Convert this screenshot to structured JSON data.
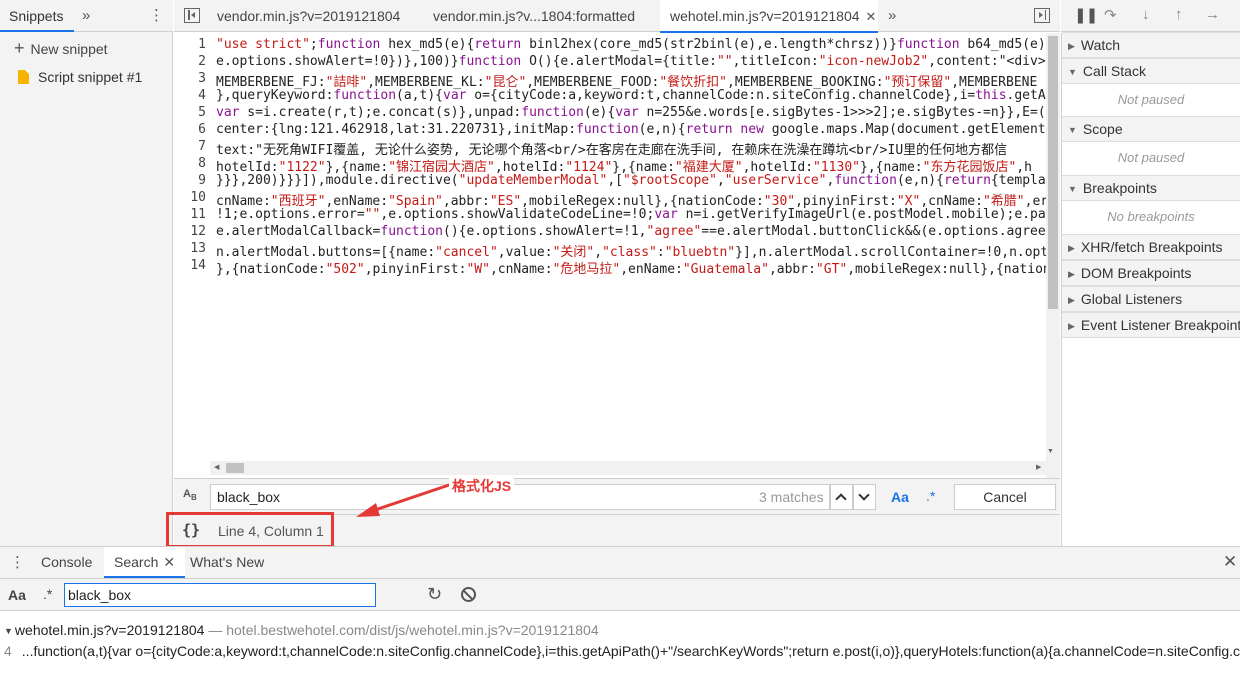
{
  "left_panel": {
    "tab": "Snippets",
    "new_snippet": "New snippet",
    "snippets": [
      "Script snippet #1"
    ]
  },
  "editor": {
    "tabs": [
      "vendor.min.js?v=2019121804",
      "vendor.min.js?v...1804:formatted",
      "wehotel.min.js?v=2019121804"
    ],
    "active_tab_index": 2,
    "line_numbers": [
      "1",
      "2",
      "3",
      "4",
      "5",
      "6",
      "7",
      "8",
      "9",
      "10",
      "11",
      "12",
      "13",
      "14"
    ],
    "lines": [
      "\"use strict\";function hex_md5(e){return binl2hex(core_md5(str2binl(e),e.length*chrsz))}function b64_md5(e){",
      "e.options.showAlert=!0})},100)}function O(){e.alertModal={title:\"\",titleIcon:\"icon-newJob2\",content:\"<div><",
      "MEMBERBENE_FJ:\"詰啡\",MEMBERBENE_KL:\"昆仑\",MEMBERBENE_FOOD:\"餐饮折扣\",MEMBERBENE_BOOKING:\"预订保留\",MEMBERBENE",
      "},queryKeyword:function(a,t){var o={cityCode:a,keyword:t,channelCode:n.siteConfig.channelCode},i=this.getAp",
      "var s=i.create(r,t);e.concat(s)},unpad:function(e){var n=255&e.words[e.sigBytes-1>>>2];e.sigBytes-=n}},E=(t",
      "center:{lng:121.462918,lat:31.220731},initMap:function(e,n){return new google.maps.Map(document.getElementB",
      "text:\"无死角WIFI覆盖, 无论什么姿势, 无论哪个角落<br/>在客房在走廊在洗手间, 在赖床在洗澡在蹲坑<br/>IU里的任何地方都信",
      "hotelId:\"1122\"},{name:\"锦江宿园大酒店\",hotelId:\"1124\"},{name:\"福建大厦\",hotelId:\"1130\"},{name:\"东方花园饭店\",h",
      "}}},200)}}}]),module.directive(\"updateMemberModal\",[\"$rootScope\",\"userService\",function(e,n){return{templat",
      "cnName:\"西班牙\",enName:\"Spain\",abbr:\"ES\",mobileRegex:null},{nationCode:\"30\",pinyinFirst:\"X\",cnName:\"希腊\",er",
      "!1;e.options.error=\"\",e.options.showValidateCodeLine=!0;var n=i.getVerifyImageUrl(e.postModel.mobile);e.par",
      "e.alertModalCallback=function(){e.options.showAlert=!1,\"agree\"==e.alertModal.buttonClick&&(e.options.agreeT",
      "n.alertModal.buttons=[{name:\"cancel\",value:\"关闭\",\"class\":\"bluebtn\"}],n.alertModal.scrollContainer=!0,n.opt",
      "},{nationCode:\"502\",pinyinFirst:\"W\",cnName:\"危地马拉\",enName:\"Guatemala\",abbr:\"GT\",mobileRegex:null},{nation"
    ]
  },
  "find_bar": {
    "query": "black_box",
    "match_count": "3 matches",
    "match_case": "Aa",
    "regex": ".*",
    "cancel": "Cancel"
  },
  "status_bar": {
    "pretty_print": "{}",
    "cursor": "Line 4, Column 1"
  },
  "annotation": {
    "label": "格式化JS",
    "color": "#e53935"
  },
  "debugger": {
    "sections": [
      {
        "label": "Watch",
        "expanded": false
      },
      {
        "label": "Call Stack",
        "expanded": true,
        "empty": "Not paused"
      },
      {
        "label": "Scope",
        "expanded": true,
        "empty": "Not paused"
      },
      {
        "label": "Breakpoints",
        "expanded": true,
        "empty": "No breakpoints"
      },
      {
        "label": "XHR/fetch Breakpoints",
        "expanded": false
      },
      {
        "label": "DOM Breakpoints",
        "expanded": false
      },
      {
        "label": "Global Listeners",
        "expanded": false
      },
      {
        "label": "Event Listener Breakpoints",
        "expanded": false
      }
    ]
  },
  "drawer": {
    "tabs": [
      "Console",
      "Search",
      "What's New"
    ],
    "active_tab": "Search",
    "search_input": "black_box",
    "aa": "Aa",
    "regex": ".*",
    "result_file": "wehotel.min.js?v=2019121804",
    "result_sep": " — ",
    "result_path": "hotel.bestwehotel.com/dist/js/wehotel.min.js?v=2019121804",
    "result_line_no": "4",
    "result_text": "...function(a,t){var o={cityCode:a,keyword:t,channelCode:n.siteConfig.channelCode},i=this.getApiPath()+\"/searchKeyWords\";return e.post(i,o)},queryHotels:function(a){a.channelCode=n.siteConfig.ch"
  },
  "colors": {
    "accent": "#1a73e8",
    "annotation_red": "#e53935",
    "string_red": "#c41a16",
    "keyword_purple": "#881391"
  }
}
